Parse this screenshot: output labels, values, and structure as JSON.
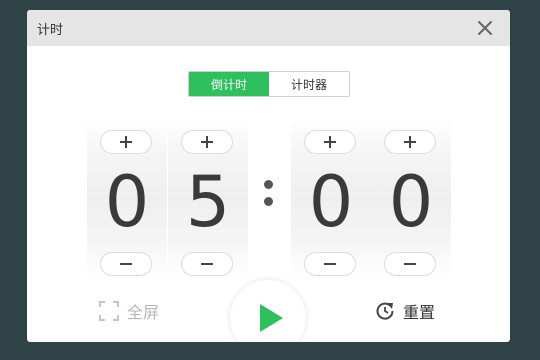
{
  "dialog": {
    "title": "计时",
    "close_icon": "close-icon"
  },
  "tabs": [
    {
      "label": "倒计时",
      "active": true
    },
    {
      "label": "计时器",
      "active": false
    }
  ],
  "timer": {
    "digits": [
      "0",
      "5",
      "0",
      "0"
    ],
    "separator": ":",
    "plus_icon": "plus-icon",
    "minus_icon": "minus-icon"
  },
  "controls": {
    "fullscreen_label": "全屏",
    "reset_label": "重置",
    "play_icon": "play-icon"
  },
  "colors": {
    "accent": "#2ec05c",
    "background": "#2f4245",
    "digit": "#3a3a3a"
  }
}
